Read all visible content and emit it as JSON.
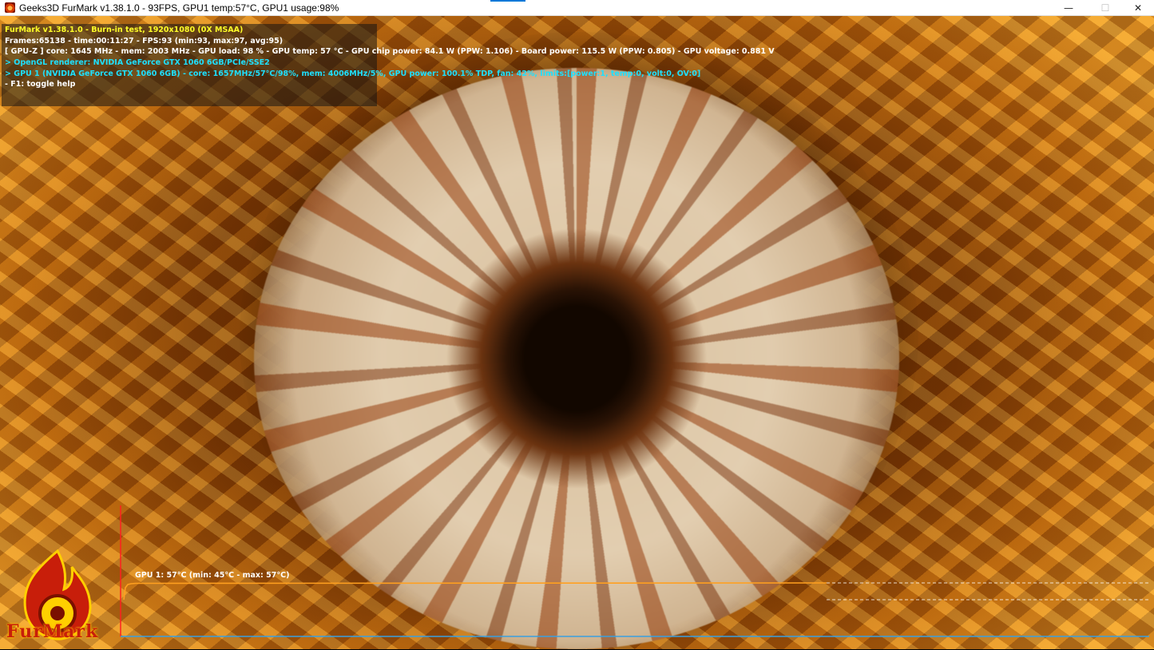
{
  "window": {
    "title": "Geeks3D FurMark v1.38.1.0 - 93FPS, GPU1 temp:57°C, GPU1 usage:98%",
    "controls": {
      "minimize": "—",
      "maximize": "☐",
      "close": "✕"
    }
  },
  "hud": {
    "line1": "FurMark v1.38.1.0 - Burn-in test, 1920x1080 (0X MSAA)",
    "line2": "Frames:65138 - time:00:11:27 - FPS:93 (min:93, max:97, avg:95)",
    "line3": "[ GPU-Z ] core: 1645 MHz - mem: 2003 MHz - GPU load: 98 % - GPU temp: 57 °C - GPU chip power: 84.1 W (PPW: 1.106) - Board power: 115.5 W (PPW: 0.805) - GPU voltage: 0.881 V",
    "line4": "> OpenGL renderer: NVIDIA GeForce GTX 1060 6GB/PCIe/SSE2",
    "line5": "> GPU 1 (NVIDIA GeForce GTX 1060 6GB) - core: 1657MHz/57°C/98%, mem: 4006MHz/5%, GPU power: 100.1% TDP, fan: 42%, limits:[power:1, temp:0, volt:0, OV:0]",
    "line6": "- F1: toggle help"
  },
  "graph": {
    "label": "GPU 1: 57°C (min: 45°C - max: 57°C)",
    "current_temp_c": 57,
    "min_temp_c": 45,
    "max_temp_c": 57
  },
  "logo": {
    "text": "FurMark"
  },
  "colors": {
    "hud_title": "#ffff28",
    "hud_text": "#ffffff",
    "hud_cyan": "#1ee0ff",
    "graph_line": "#ffa020",
    "graph_axis_y": "#ff2020",
    "graph_axis_x": "#3aa0e0"
  }
}
